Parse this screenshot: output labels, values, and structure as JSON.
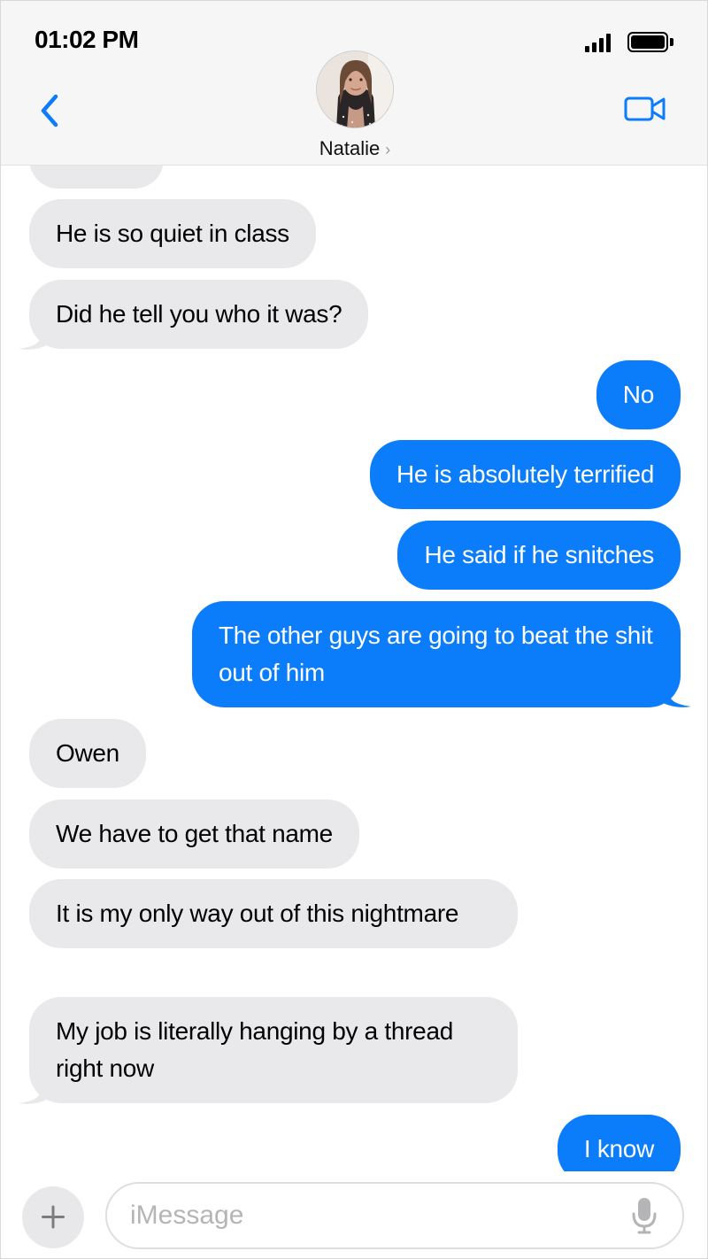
{
  "status_bar": {
    "time": "01:02 PM"
  },
  "header": {
    "contact_name": "Natalie",
    "chevron": "›"
  },
  "messages": [
    {
      "from": "them",
      "text": ""
    },
    {
      "from": "them",
      "text": "He is so quiet in class"
    },
    {
      "from": "them",
      "text": "Did he tell you who it was?"
    },
    {
      "from": "me",
      "text": "No"
    },
    {
      "from": "me",
      "text": "He is absolutely terrified"
    },
    {
      "from": "me",
      "text": "He said if he snitches"
    },
    {
      "from": "me",
      "text": "The other guys are going to beat the shit out of him"
    },
    {
      "from": "them",
      "text": "Owen"
    },
    {
      "from": "them",
      "text": "We have to get that name"
    },
    {
      "from": "them",
      "text": "It is my only way out of this nightmare"
    },
    {
      "from": "them",
      "text": "My job is literally hanging by a thread right now"
    },
    {
      "from": "me",
      "text": "I know"
    }
  ],
  "composer": {
    "placeholder": "iMessage"
  },
  "colors": {
    "outgoing": "#0b7dfb",
    "incoming": "#e9e9eb",
    "accent": "#0b7dfb"
  },
  "icons": [
    "back-chevron-icon",
    "video-call-icon",
    "plus-icon",
    "microphone-icon",
    "signal-icon",
    "battery-icon"
  ]
}
